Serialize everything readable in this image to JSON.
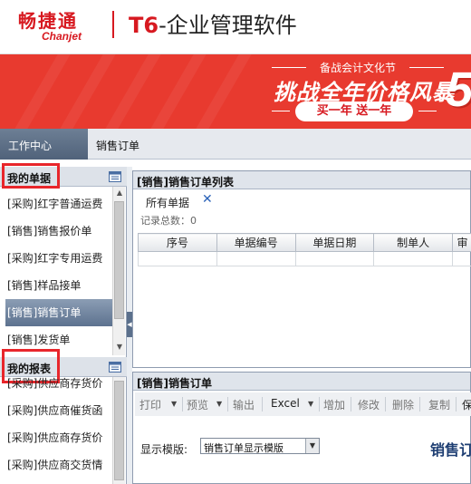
{
  "header": {
    "brand_cn": "畅捷通",
    "brand_en": "Chanjet",
    "product_prefix": "T6",
    "product_suffix": "-企业管理软件"
  },
  "banner": {
    "top_line": "备战会计文化节",
    "main_line": "挑战全年价格风暴",
    "sub_line": "买一年 送一年",
    "big_digit": "5"
  },
  "tabs": {
    "active": "工作中心",
    "second": "销售订单"
  },
  "my_docs": {
    "title": "我的单据",
    "items": [
      "[采购]红字普通运费",
      "[销售]销售报价单",
      "[采购]红字专用运费",
      "[销售]样品接单",
      "[销售]销售订单",
      "[销售]发货单"
    ]
  },
  "my_reports": {
    "title": "我的报表",
    "items": [
      "[采购]供应商存货价",
      "[采购]供应商催货函",
      "[采购]供应商存货价",
      "[采购]供应商交货情"
    ]
  },
  "list_panel": {
    "title": "[销售]销售订单列表",
    "filter": "所有单据",
    "record_count": "记录总数：0",
    "columns": [
      "序号",
      "单据编号",
      "单据日期",
      "制单人",
      "审"
    ]
  },
  "order_panel": {
    "title": "[销售]销售订单",
    "toolbar": [
      "打印",
      "预览",
      "输出",
      "Excel",
      "增加",
      "修改",
      "删除",
      "复制",
      "保"
    ],
    "template_label": "显示模版:",
    "template_value": "销售订单显示模版",
    "doc_title": "销售订"
  },
  "colors": {
    "brand_red": "#d71920",
    "banner_red": "#e83a2f",
    "highlight_red": "#e8262b",
    "tab_active": "#5b6e86"
  }
}
